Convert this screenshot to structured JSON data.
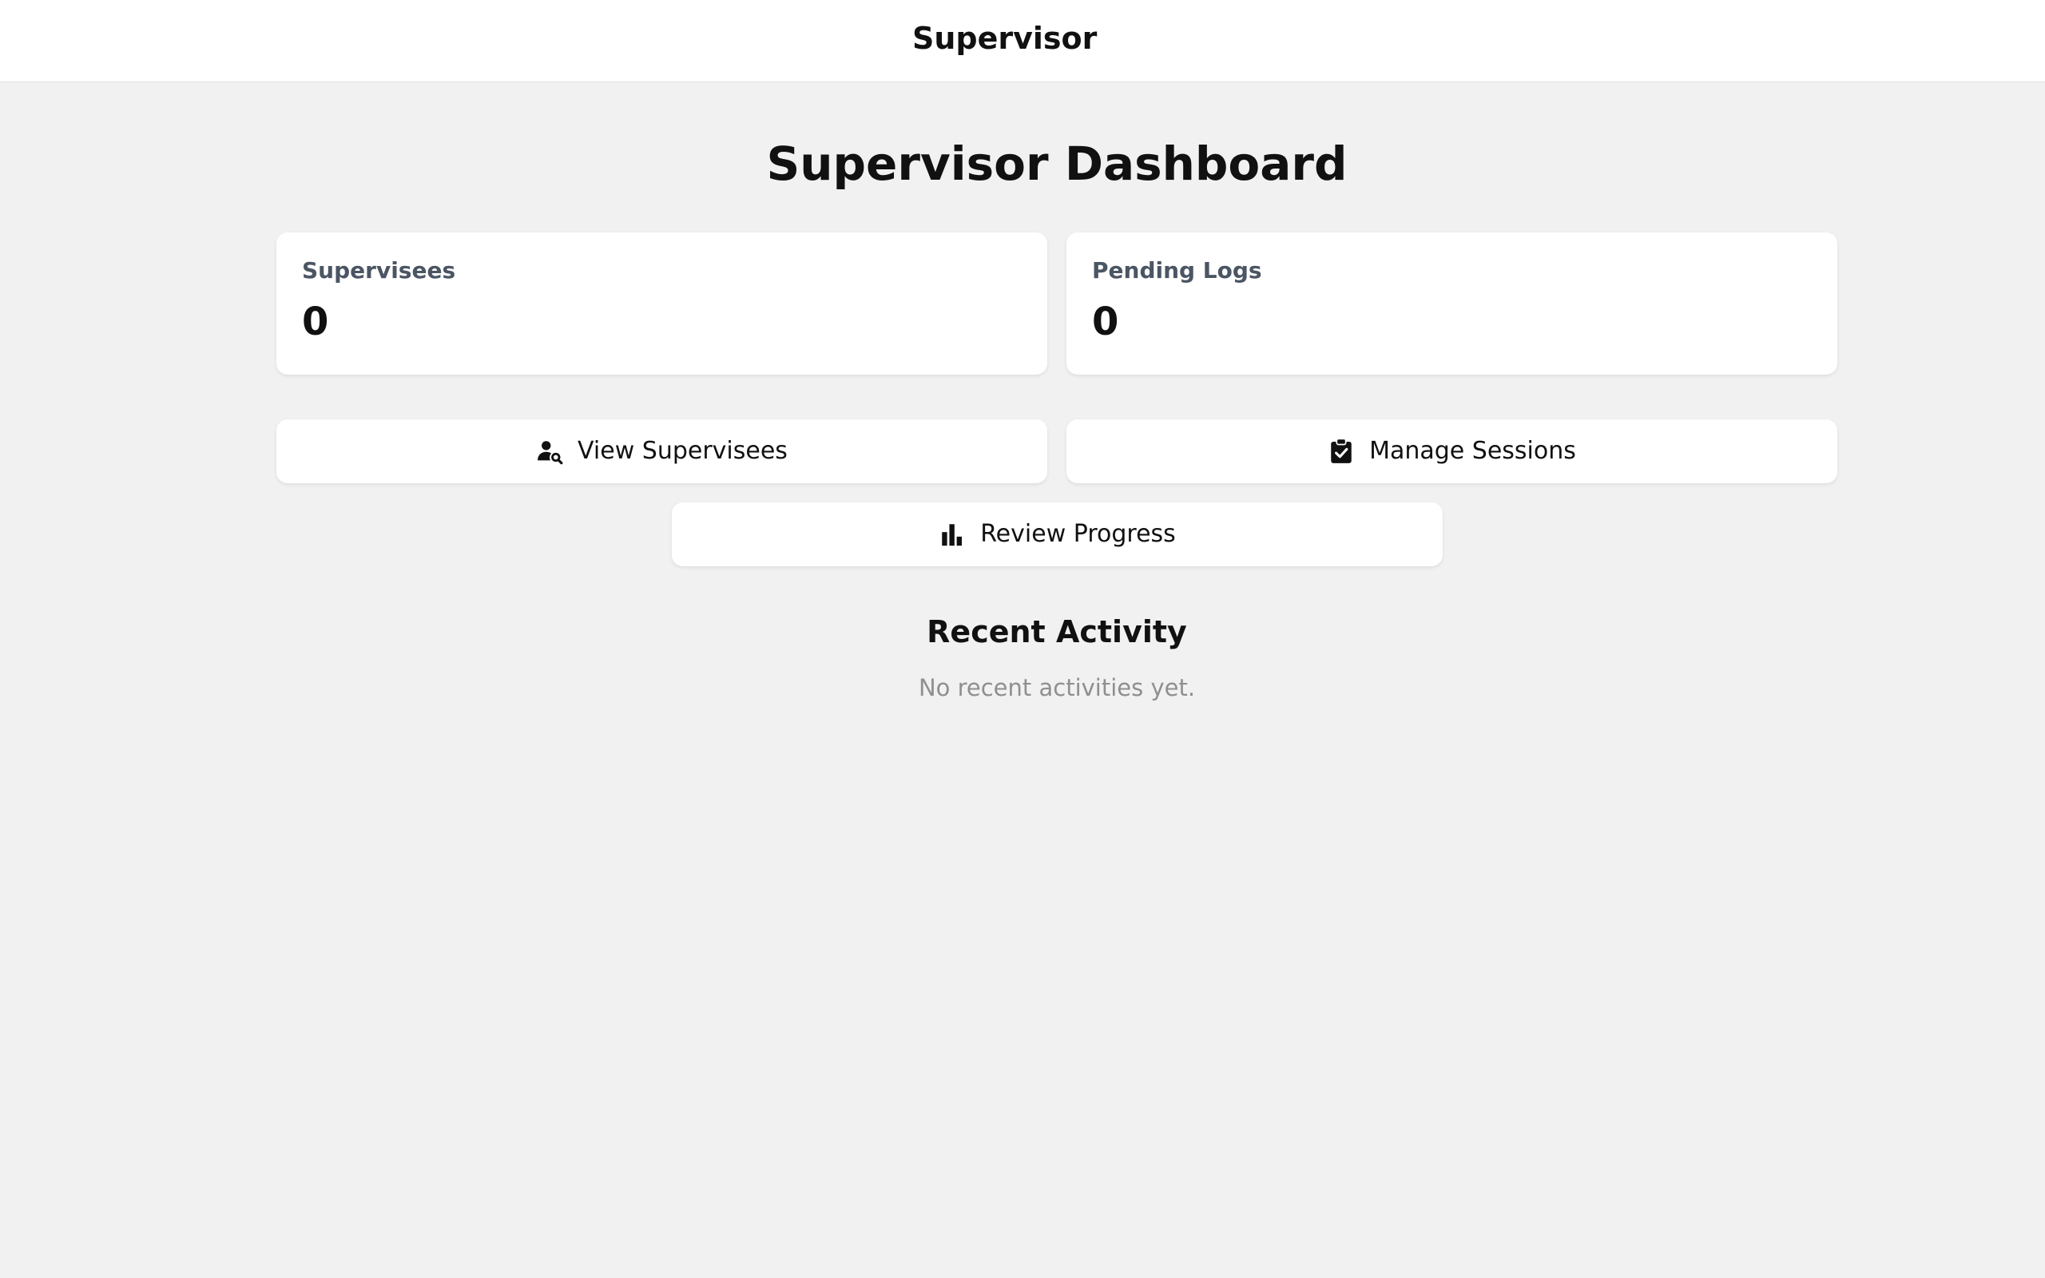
{
  "header": {
    "title": "Supervisor"
  },
  "main": {
    "title": "Supervisor Dashboard",
    "stats": [
      {
        "label": "Supervisees",
        "value": "0"
      },
      {
        "label": "Pending Logs",
        "value": "0"
      }
    ],
    "actions": {
      "view_supervisees": {
        "label": "View Supervisees",
        "icon": "user-search-icon"
      },
      "manage_sessions": {
        "label": "Manage Sessions",
        "icon": "clipboard-check-icon"
      },
      "review_progress": {
        "label": "Review Progress",
        "icon": "bar-chart-icon"
      }
    },
    "recent_activity": {
      "title": "Recent Activity",
      "empty_text": "No recent activities yet."
    }
  },
  "colors": {
    "page_background": "#f1f1f1",
    "card_background": "#ffffff",
    "stat_label": "#4b5563",
    "muted_text": "#8f8f8f"
  }
}
